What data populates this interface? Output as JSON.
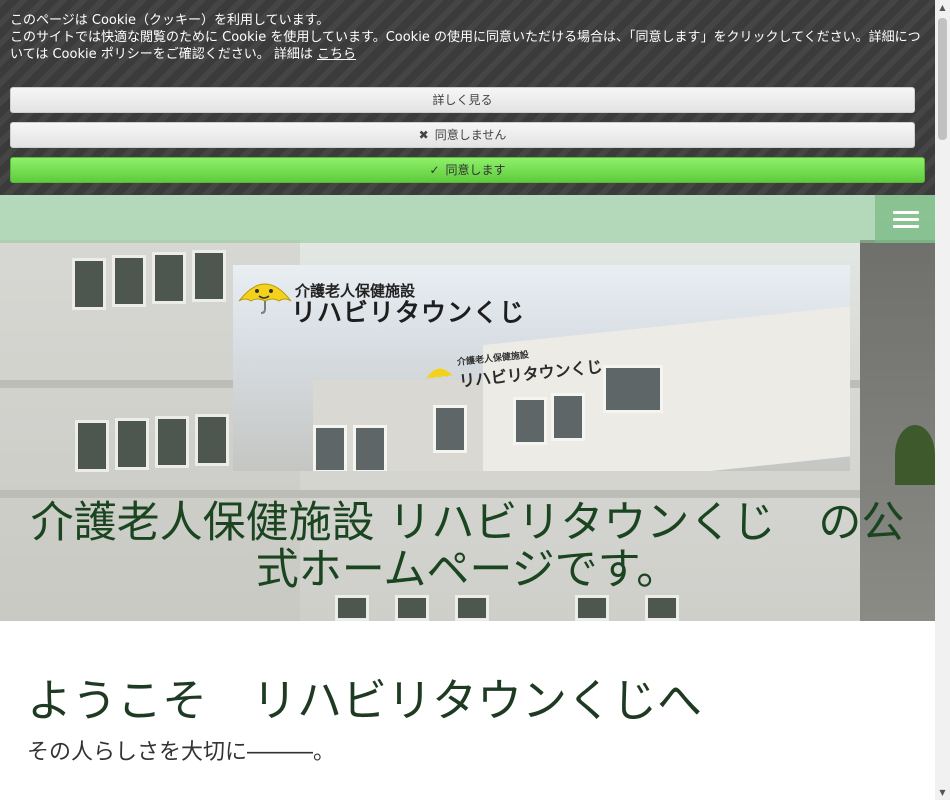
{
  "cookie_banner": {
    "line1": "このページは Cookie（クッキー）を利用しています。",
    "line2": "このサイトでは快適な閲覧のために Cookie を使用しています。Cookie の使用に同意いただける場合は、「同意します」をクリックしてください。詳細については Cookie ポリシーをご確認ください。 詳細は",
    "details_link": "こちら",
    "more_button": "詳しく見る",
    "decline_button": "同意しません",
    "accept_button": "同意します",
    "decline_icon": "times-icon",
    "accept_icon": "check-icon"
  },
  "nav": {
    "menu_icon": "hamburger-icon"
  },
  "logo": {
    "small_text": "介護老人保健施設",
    "large_text": "リハビリタウンくじ"
  },
  "hero": {
    "headline": "介護老人保健施設 リハビリタウンくじ　の公式ホームページです。"
  },
  "main": {
    "welcome_heading": "ようこそ　リハビリタウンくじへ",
    "tagline": "その人らしさを大切に―――。"
  },
  "colors": {
    "accent_green": "#5fcb3c",
    "heading_green": "#1a4520",
    "banner_bg": "#3b3b3b"
  }
}
